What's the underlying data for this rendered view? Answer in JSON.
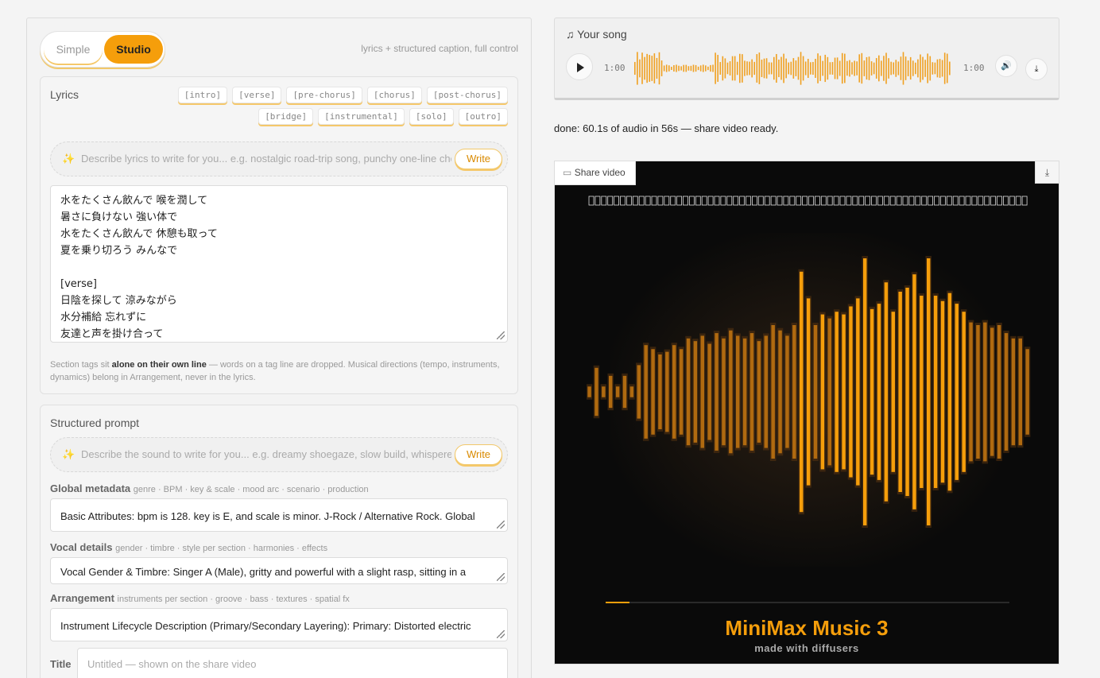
{
  "mode": {
    "simple": "Simple",
    "studio": "Studio",
    "hint": "lyrics + structured caption, full control"
  },
  "lyrics": {
    "title": "Lyrics",
    "tags": [
      "[intro]",
      "[verse]",
      "[pre-chorus]",
      "[chorus]",
      "[post-chorus]",
      "[bridge]",
      "[instrumental]",
      "[solo]",
      "[outro]"
    ],
    "ai_placeholder": "Describe lyrics to write for you...  e.g. nostalgic road-trip song, punchy one-line chorus",
    "write": "Write",
    "lines": [
      "水をたくさん飲んで 喉を潤して",
      "暑さに負けない 強い体で",
      "水をたくさん飲んで 休憩も取って",
      "夏を乗り切ろう みんなで",
      "",
      "[verse]",
      "日陰を探して 涼みながら",
      "水分補給 忘れずに",
      "友達と声を掛け合って"
    ],
    "note_pre": "Section tags sit ",
    "note_bold": "alone on their own line",
    "note_post": " — words on a tag line are dropped. Musical directions (tempo, instruments, dynamics) belong in Arrangement, never in the lyrics."
  },
  "prompt": {
    "title": "Structured prompt",
    "ai_placeholder": "Describe the sound to write for you...  e.g. dreamy shoegaze, slow build, whispered vocals",
    "write": "Write",
    "global_label": "Global metadata",
    "global_sub": "genre · BPM · key & scale · mood arc · scenario · production",
    "global_value": "Basic Attributes: bpm is 128. key is E, and scale is minor. J-Rock / Alternative Rock. Global",
    "vocal_label": "Vocal details",
    "vocal_sub": "gender · timbre · style per section · harmonies · effects",
    "vocal_value": "Vocal Gender & Timbre: Singer A (Male), gritty and powerful with a slight rasp, sitting in a",
    "arr_label": "Arrangement",
    "arr_sub": "instruments per section · groove · bass · textures · spatial fx",
    "arr_value": "Instrument Lifecycle Description (Primary/Secondary Layering): Primary: Distorted electric",
    "title_label": "Title",
    "title_placeholder": "Untitled — shown on the share video"
  },
  "player": {
    "label": "♫ Your song",
    "time_left": "1:00",
    "time_right": "1:00"
  },
  "status": "done: 60.1s of audio in 56s — share video ready.",
  "video": {
    "share": "Share video",
    "heading": "MiniMax Music 3",
    "sub": "made with diffusers",
    "progress": 0.06,
    "accent": "#f59e0b"
  }
}
